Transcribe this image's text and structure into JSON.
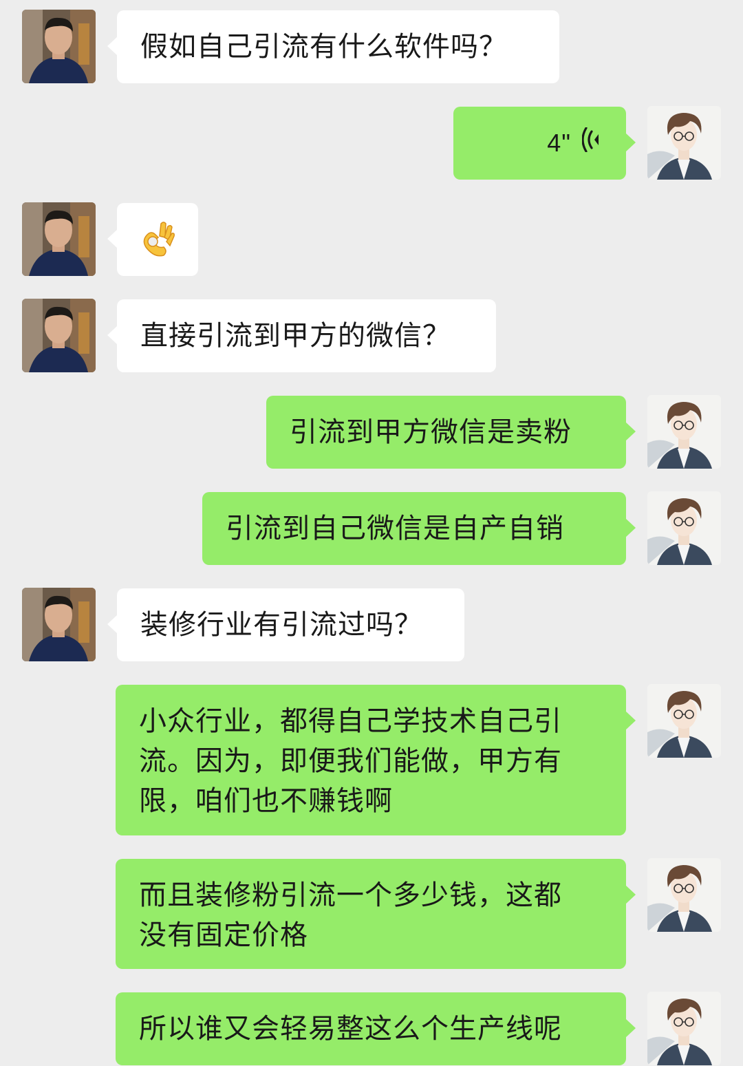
{
  "colors": {
    "background": "#ededed",
    "incoming_bubble": "#ffffff",
    "outgoing_bubble": "#95ec69"
  },
  "messages": [
    {
      "side": "left",
      "type": "text",
      "text": "假如自己引流有什么软件吗？"
    },
    {
      "side": "right",
      "type": "voice",
      "duration": "4\"",
      "icon": "voice-wave-icon"
    },
    {
      "side": "left",
      "type": "emoji",
      "icon": "ok-hand-emoji"
    },
    {
      "side": "left",
      "type": "text",
      "text": "直接引流到甲方的微信？"
    },
    {
      "side": "right",
      "type": "text",
      "text": "引流到甲方微信是卖粉"
    },
    {
      "side": "right",
      "type": "text",
      "text": "引流到自己微信是自产自销"
    },
    {
      "side": "left",
      "type": "text",
      "text": "装修行业有引流过吗？"
    },
    {
      "side": "right",
      "type": "text",
      "lines": [
        "小众行业，都得自己学技术自己引",
        "流。因为，即便我们能做，甲方有",
        "限，咱们也不赚钱啊"
      ]
    },
    {
      "side": "right",
      "type": "text",
      "lines": [
        "而且装修粉引流一个多少钱，这都",
        "没有固定价格"
      ]
    },
    {
      "side": "right",
      "type": "text",
      "text": "所以谁又会轻易整这么个生产线呢"
    }
  ]
}
